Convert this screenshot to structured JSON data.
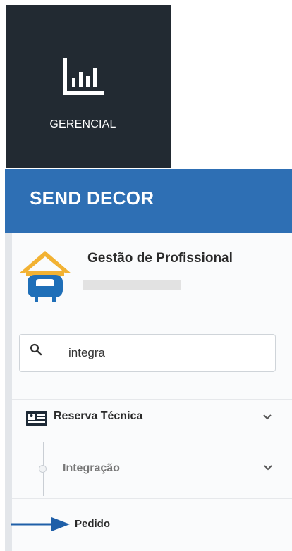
{
  "tile": {
    "label": "GERENCIAL",
    "icon": "bar-chart-icon"
  },
  "header": {
    "brand": "SEND DECOR"
  },
  "profile": {
    "name": "Gestão de Profissional",
    "icon": "home-sofa-icon"
  },
  "search": {
    "value": "integra",
    "icon": "search-icon"
  },
  "menu": {
    "reserva": {
      "label": "Reserva Técnica",
      "icon": "id-card-icon"
    },
    "integracao": {
      "label": "Integração"
    },
    "pedido": {
      "label": "Pedido"
    }
  },
  "colors": {
    "tile_bg": "#222a32",
    "header_bg": "#2e6fb4",
    "arrow": "#1f5fa8"
  }
}
